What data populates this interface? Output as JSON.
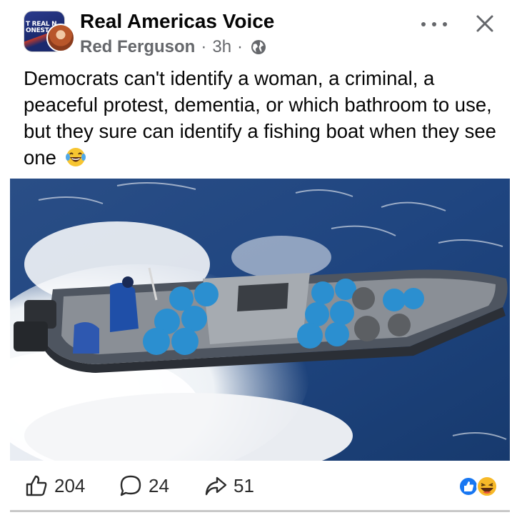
{
  "post": {
    "page_name": "Real Americas Voice",
    "author": "Red Ferguson",
    "time": "3h",
    "separator": "·",
    "avatar_logo_line1": "T REAL N",
    "avatar_logo_line2": "ONEST",
    "text": "Democrats can't identify a woman, a criminal, a peaceful protest, dementia, or which bathroom to use, but they sure can identify a fishing boat when they see one",
    "text_emoji": "laughing-with-tears-emoji",
    "privacy_icon": "globe-icon"
  },
  "image": {
    "description_icon": "speedboat-photo"
  },
  "actions": {
    "like_count": "204",
    "comment_count": "24",
    "share_count": "51",
    "reaction_icons": [
      "like-reaction-icon",
      "haha-reaction-icon"
    ]
  },
  "colors": {
    "text": "#050505",
    "secondary": "#65676b",
    "like_blue": "#1877f2",
    "haha_yellow": "#f7b928"
  }
}
